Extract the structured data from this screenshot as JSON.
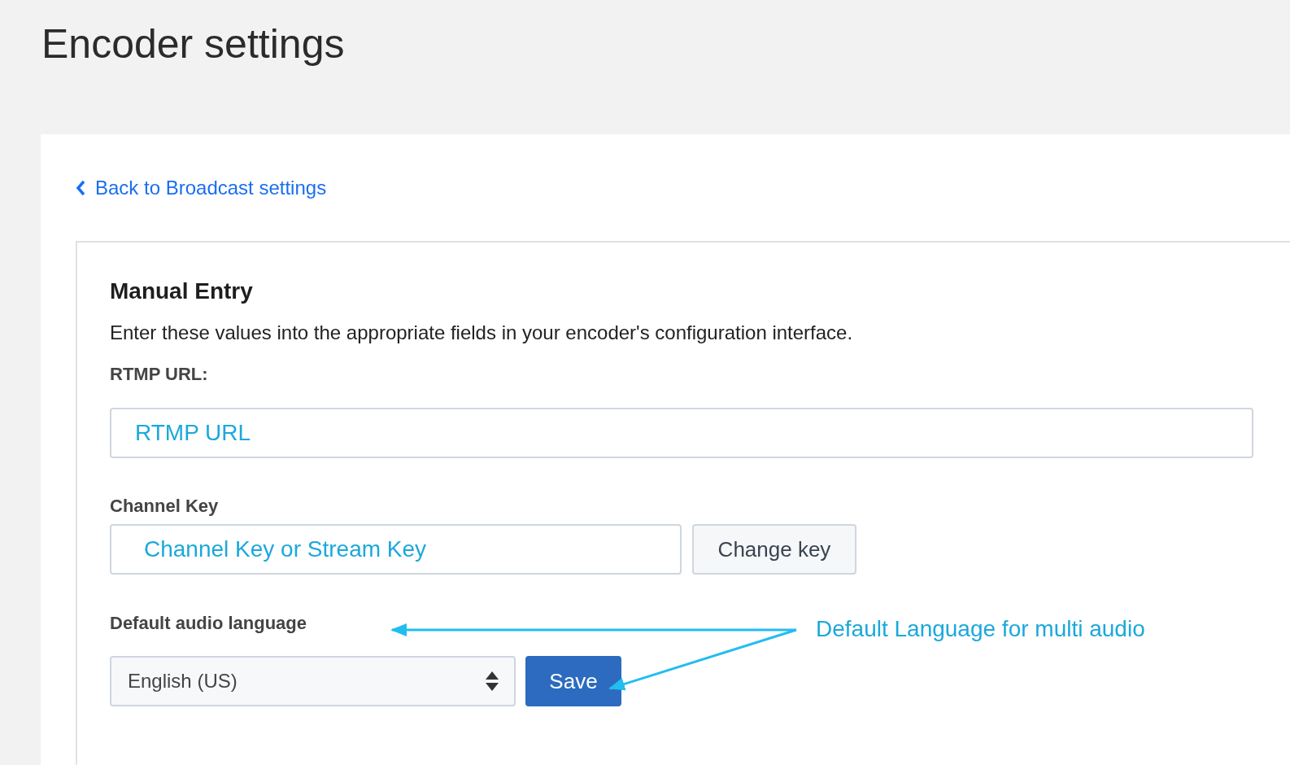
{
  "page_title": "Encoder settings",
  "back_link": {
    "label": "Back to Broadcast settings"
  },
  "section": {
    "heading": "Manual Entry",
    "description": "Enter these values into the appropriate fields in your encoder's configuration interface.",
    "rtmp": {
      "label": "RTMP URL:",
      "value": "RTMP URL"
    },
    "channel_key": {
      "label": "Channel Key",
      "value": "Channel Key or Stream Key",
      "button": "Change key"
    },
    "audio_language": {
      "label": "Default audio language",
      "value": "English (US)",
      "button": "Save"
    }
  },
  "annotation": {
    "text": "Default Language for multi audio"
  }
}
